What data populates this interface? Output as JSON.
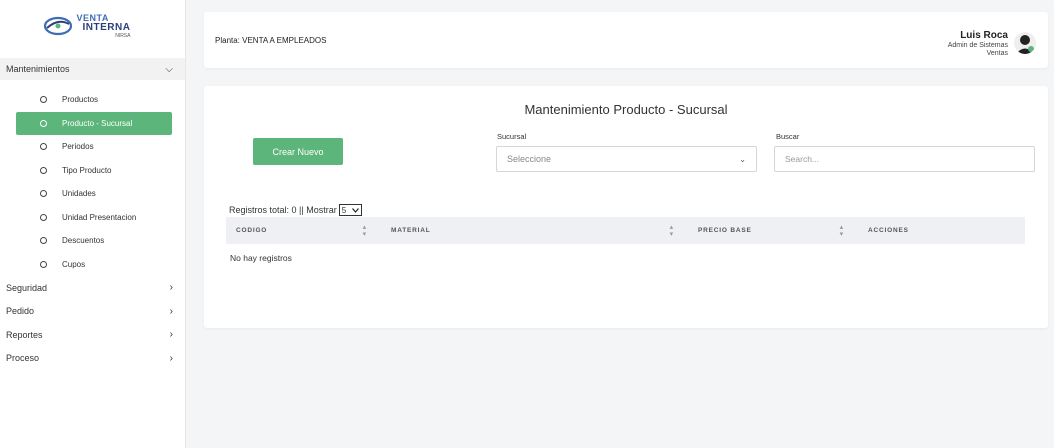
{
  "logo": {
    "line1": "VENTA",
    "line2": "INTERNA",
    "line3": "NIRSA"
  },
  "sidebar": {
    "open_section": "Mantenimientos",
    "items": [
      {
        "label": "Productos",
        "active": false
      },
      {
        "label": "Producto - Sucursal",
        "active": true
      },
      {
        "label": "Periodos",
        "active": false
      },
      {
        "label": "Tipo Producto",
        "active": false
      },
      {
        "label": "Unidades",
        "active": false
      },
      {
        "label": "Unidad Presentacion",
        "active": false
      },
      {
        "label": "Descuentos",
        "active": false
      },
      {
        "label": "Cupos",
        "active": false
      }
    ],
    "sections": [
      "Seguridad",
      "Pedido",
      "Reportes",
      "Proceso"
    ]
  },
  "header": {
    "planta": "Planta: VENTA A EMPLEADOS",
    "user_name": "Luis Roca",
    "user_role_1": "Admin de Sistemas",
    "user_role_2": "Ventas"
  },
  "main": {
    "title": "Mantenimiento Producto - Sucursal",
    "create_button": "Crear Nuevo",
    "sucursal_label": "Sucursal",
    "sucursal_value": "Seleccione",
    "buscar_label": "Buscar",
    "search_placeholder": "Search...",
    "registros_text": "Registros total: 0 || Mostrar",
    "mostrar_value": "5",
    "columns": [
      "CODIGO",
      "MATERIAL",
      "PRECIO BASE",
      "ACCIONES"
    ],
    "empty_text": "No hay registros"
  },
  "colors": {
    "accent": "#5cb57a",
    "header_row": "#eef0f4"
  }
}
